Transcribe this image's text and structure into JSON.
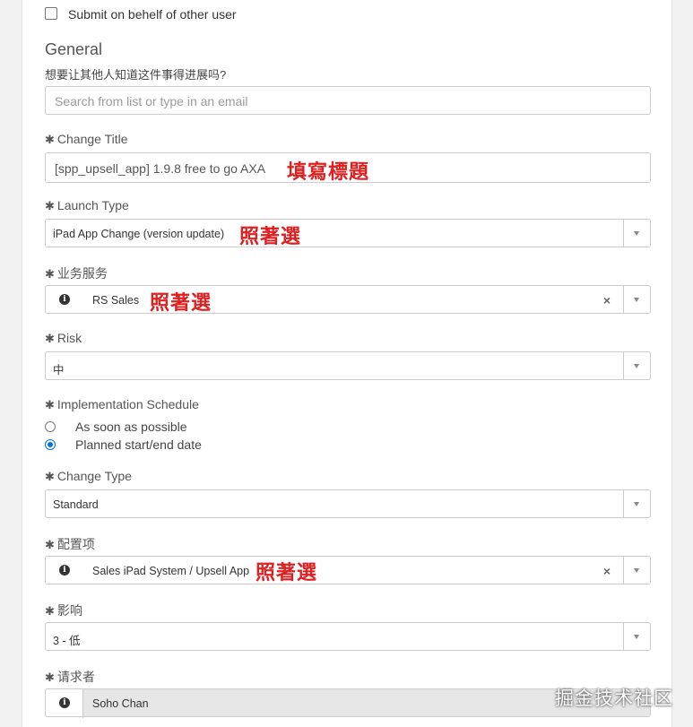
{
  "submit_on_behalf": {
    "label": "Submit on behelf of other user",
    "checked": false
  },
  "general": {
    "title": "General",
    "subtitle": "想要让其他人知道这件事得进展吗?",
    "watch_placeholder": "Search from list or type in an email"
  },
  "required_mark": "✱",
  "fields": {
    "change_title": {
      "label": "Change Title",
      "value": "[spp_upsell_app] 1.9.8 free to go AXA",
      "annotation": "填寫標題"
    },
    "launch_type": {
      "label": "Launch Type",
      "value": "iPad App Change (version update)",
      "annotation": "照著選"
    },
    "business_service": {
      "label": "业务服务",
      "value": "RS Sales",
      "annotation": "照著選"
    },
    "risk": {
      "label": "Risk",
      "value": "中"
    },
    "implementation_schedule": {
      "label": "Implementation Schedule",
      "options": [
        "As soon as possible",
        "Planned start/end date"
      ],
      "selected": "Planned start/end date"
    },
    "change_type": {
      "label": "Change Type",
      "value": "Standard"
    },
    "config_item": {
      "label": "配置项",
      "value": "Sales iPad System / Upsell App",
      "annotation": "照著選"
    },
    "impact": {
      "label": "影响",
      "value": "3 - 低"
    },
    "requester": {
      "label": "请求者",
      "value": "Soho Chan"
    }
  },
  "icons": {
    "info": "i",
    "clear": "×",
    "dropdown": "chevron-down-icon"
  },
  "watermark": "掘金技术社区",
  "colors": {
    "annotation": "#e02020",
    "radio_selected": "#0a6fd6"
  }
}
